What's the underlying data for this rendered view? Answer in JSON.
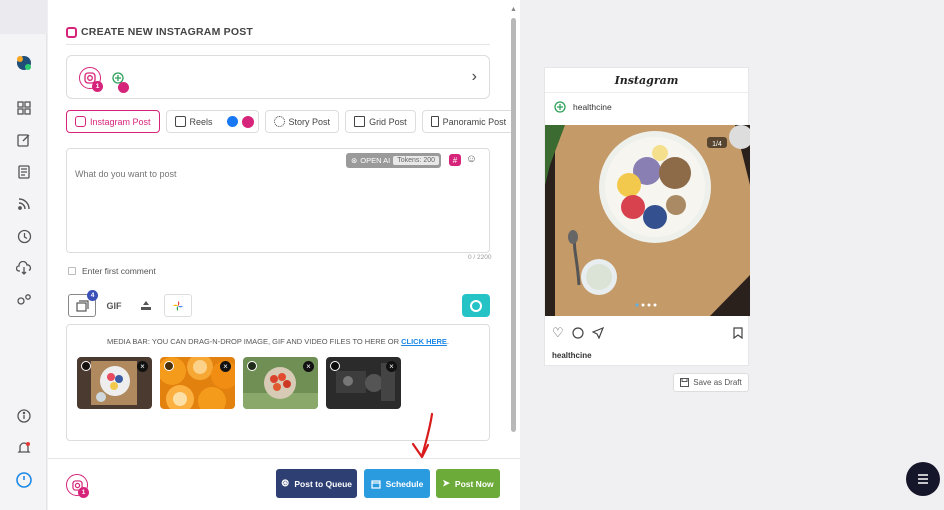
{
  "page": {
    "title": "CREATE NEW INSTAGRAM POST"
  },
  "accounts": {
    "ig_badge_count": "1",
    "footer_badge_count": "1"
  },
  "tabs": [
    {
      "label": "Instagram Post",
      "active": true
    },
    {
      "label": "Reels",
      "active": false
    },
    {
      "label": "Story Post",
      "active": false
    },
    {
      "label": "Grid Post",
      "active": false
    },
    {
      "label": "Panoramic Post",
      "active": false
    }
  ],
  "editor": {
    "placeholder": "What do you want to post",
    "openai_label": "OPEN AI",
    "tokens_label": "Tokens: 200",
    "char_counter": "0 / 2200"
  },
  "first_comment": {
    "label": "Enter first comment"
  },
  "media_tools": {
    "selected_count": "4",
    "gif_label": "GIF"
  },
  "media_bar": {
    "text": "MEDIA BAR: YOU CAN DRAG-N-DROP IMAGE, GIF AND VIDEO FILES TO HERE OR ",
    "link": "CLICK HERE",
    "suffix": "."
  },
  "footer": {
    "queue_label": "Post to Queue",
    "schedule_label": "Schedule",
    "post_now_label": "Post Now"
  },
  "preview": {
    "header": "Instagram",
    "username": "healthcine",
    "counter": "1/4",
    "caption_user": "healthcine"
  },
  "draft_button": "Save as Draft",
  "colors": {
    "instagram_accent": "#d6247a",
    "queue_button": "#2e3f74",
    "schedule_button": "#2b9be0",
    "post_now_button": "#6cab3a",
    "canva_button": "#25c3c6",
    "arrow": "#d81b1b"
  }
}
